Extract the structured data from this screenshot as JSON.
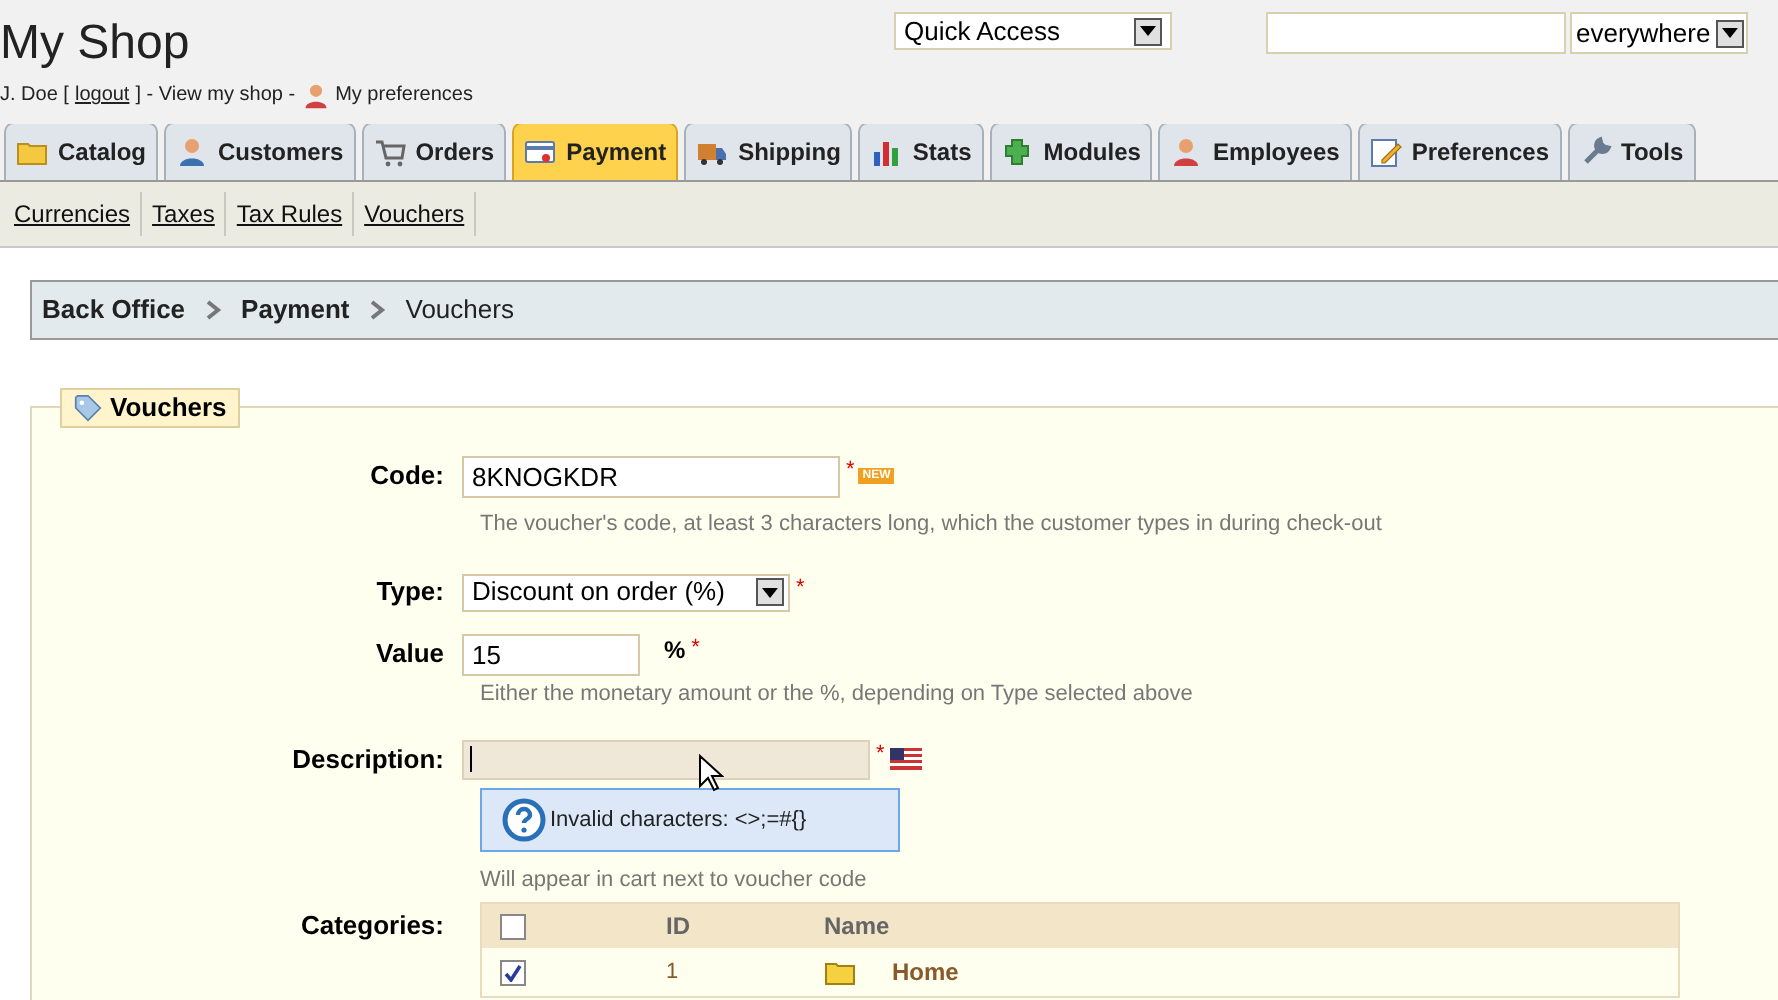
{
  "header": {
    "title": "My Shop",
    "quick_access": "Quick Access",
    "search": {
      "scope": "everywhere"
    }
  },
  "user_bar": [
    {
      "kind": "text",
      "text": "J. Doe ["
    },
    {
      "kind": "link",
      "text": "logout"
    },
    {
      "kind": "text",
      "text": "] - View my shop -"
    },
    {
      "kind": "icon-link",
      "text": "My preferences"
    }
  ],
  "tabs": [
    {
      "label": "Catalog",
      "selected": false
    },
    {
      "label": "Customers",
      "selected": false
    },
    {
      "label": "Orders",
      "selected": false
    },
    {
      "label": "Payment",
      "selected": true
    },
    {
      "label": "Shipping",
      "selected": false
    },
    {
      "label": "Stats",
      "selected": false
    },
    {
      "label": "Modules",
      "selected": false
    },
    {
      "label": "Employees",
      "selected": false
    },
    {
      "label": "Preferences",
      "selected": false
    },
    {
      "label": "Tools",
      "selected": false
    }
  ],
  "subtabs": [
    "Currencies",
    "Taxes",
    "Tax Rules",
    "Vouchers"
  ],
  "breadcrumb": [
    {
      "text": "Back Office",
      "bold": true
    },
    {
      "text": "Payment",
      "bold": true
    },
    {
      "text": "Vouchers",
      "bold": false
    }
  ],
  "form": {
    "legend": "Vouchers",
    "code": {
      "label": "Code:",
      "value": "8KNOGKDR",
      "required": "*",
      "badge": "NEW",
      "help": "The voucher's code, at least 3 characters long, which the customer types in during check-out"
    },
    "type": {
      "label": "Type:",
      "value": "Discount on order (%)",
      "required": "*"
    },
    "value": {
      "label": "Value",
      "value": "15",
      "unit": "%",
      "required": "*",
      "help": "Either the monetary amount or the %, depending on Type selected above"
    },
    "description": {
      "label": "Description:",
      "required": "*",
      "tooltip": "Invalid characters: <>;=#{}",
      "help": "Will appear in cart next to voucher code"
    },
    "categories": {
      "label": "Categories:",
      "all_checked": false,
      "columns": [
        "ID",
        "Name"
      ],
      "rows": [
        {
          "checked": true,
          "id": "1",
          "name": "Home"
        }
      ]
    }
  }
}
